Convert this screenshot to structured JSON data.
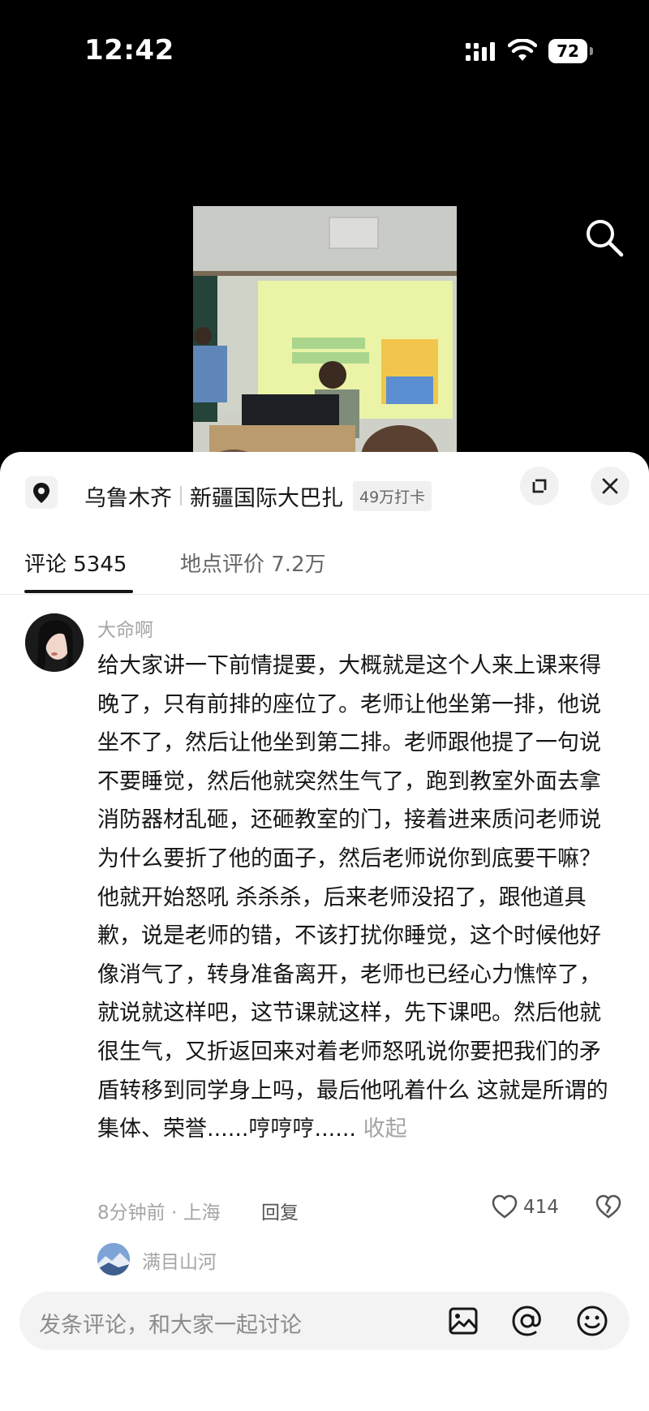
{
  "status_bar": {
    "time": "12:42",
    "battery": "72"
  },
  "location": {
    "city": "乌鲁木齐",
    "place": "新疆国际大巴扎",
    "checkins": "49万打卡"
  },
  "tabs": [
    {
      "label": "评论 5345",
      "active": true
    },
    {
      "label": "地点评价 7.2万",
      "active": false
    }
  ],
  "comment": {
    "username": "大命啊",
    "text": "给大家讲一下前情提要，大概就是这个人来上课来得晚了，只有前排的座位了。老师让他坐第一排，他说坐不了，然后让他坐到第二排。老师跟他提了一句说不要睡觉，然后他就突然生气了，跑到教室外面去拿消防器材乱砸，还砸教室的门，接着进来质问老师说为什么要折了他的面子，然后老师说你到底要干嘛？他就开始怒吼 杀杀杀，后来老师没招了，跟他道具歉，说是老师的错，不该打扰你睡觉，这个时候他好像消气了，转身准备离开，老师也已经心力憔悴了，就说就这样吧，这节课就这样，先下课吧。然后他就很生气，又折返回来对着老师怒吼说你要把我们的矛盾转移到同学身上吗，最后他吼着什么 这就是所谓的集体、荣誉......哼哼哼......",
    "collapse": "收起",
    "meta": "8分钟前 · 上海",
    "reply_label": "回复",
    "likes": "414"
  },
  "reply_preview": {
    "username": "满目山河"
  },
  "input": {
    "placeholder": "发条评论，和大家一起讨论"
  },
  "icons": {
    "search": "search-icon",
    "location": "location-pin-icon",
    "expand": "expand-icon",
    "close": "close-icon",
    "like": "heart-icon",
    "dislike": "broken-heart-icon",
    "image": "image-icon",
    "mention": "at-icon",
    "emoji": "emoji-icon"
  }
}
